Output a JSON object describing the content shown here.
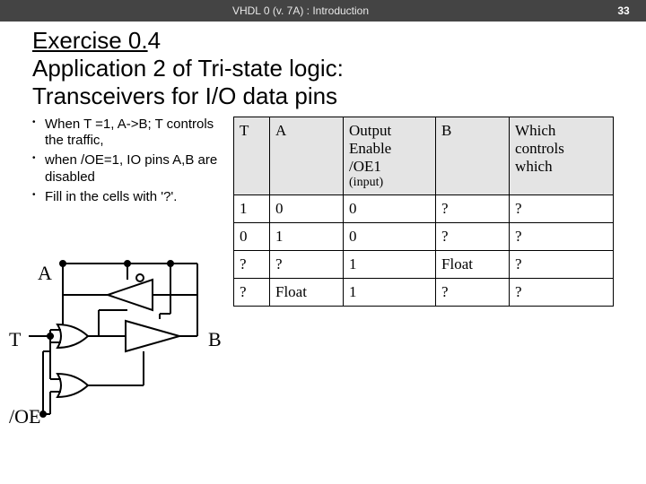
{
  "header": {
    "title": "VHDL 0 (v. 7A) : Introduction",
    "page": "33"
  },
  "title": {
    "line1a": "Exercise 0.",
    "line1b": "4",
    "line2": "Application 2 of Tri-state logic:",
    "line3": "Transceivers for I/O data pins"
  },
  "bullets": [
    "When T =1, A->B; T controls the traffic,",
    "when /OE=1, IO pins A,B are disabled",
    "Fill in the cells with '?'."
  ],
  "table": {
    "headers": {
      "c0": "T",
      "c1": "A",
      "c2_l1": "Output",
      "c2_l2": "Enable",
      "c2_l3": "/OE1",
      "c2_l4": "(input)",
      "c3": "B",
      "c4_l1": "Which",
      "c4_l2": "controls",
      "c4_l3": "which"
    },
    "rows": [
      {
        "c0": "1",
        "c1": "0",
        "c2": "0",
        "c3": "?",
        "c4": "?"
      },
      {
        "c0": "0",
        "c1": "1",
        "c2": "0",
        "c3": "?",
        "c4": "?"
      },
      {
        "c0": "?",
        "c1": "?",
        "c2": "1",
        "c3": "Float",
        "c4": "?"
      },
      {
        "c0": "?",
        "c1": "Float",
        "c2": "1",
        "c3": "?",
        "c4": "?"
      }
    ]
  },
  "diagram": {
    "A": "A",
    "B": "B",
    "T": "T",
    "OE": "/OE"
  },
  "chart_data": {
    "type": "table",
    "title": "Tri-state transceiver truth table",
    "columns": [
      "T",
      "A",
      "Output Enable /OE1 (input)",
      "B",
      "Which controls which"
    ],
    "rows": [
      [
        "1",
        "0",
        "0",
        "?",
        "?"
      ],
      [
        "0",
        "1",
        "0",
        "?",
        "?"
      ],
      [
        "?",
        "?",
        "1",
        "Float",
        "?"
      ],
      [
        "?",
        "Float",
        "1",
        "?",
        "?"
      ]
    ]
  }
}
